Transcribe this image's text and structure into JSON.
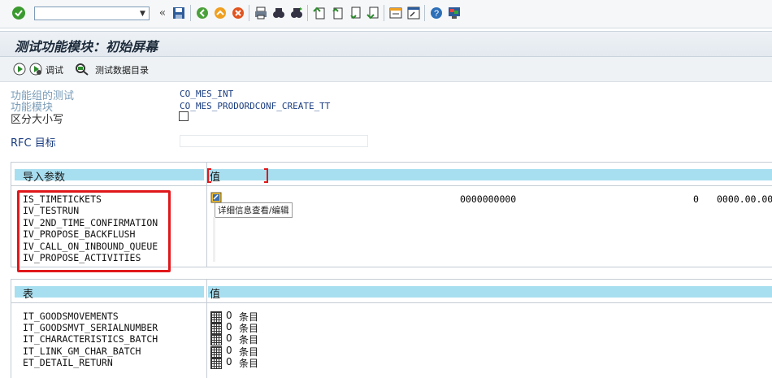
{
  "toolbar": {
    "command_field_value": "",
    "icons": [
      "enter-check-icon",
      "command-field",
      "nav-back-double-icon",
      "save-icon",
      "back-icon",
      "exit-icon",
      "cancel-icon",
      "print-icon",
      "find-icon",
      "find-next-icon",
      "first-page-icon",
      "previous-page-icon",
      "next-page-icon",
      "last-page-icon",
      "create-session-icon",
      "shortcut-icon",
      "help-icon",
      "customize-layout-icon"
    ]
  },
  "title": "测试功能模块：初始屏幕",
  "app_toolbar": {
    "test_label": "调试",
    "test_data_directory_label": "测试数据目录"
  },
  "fields": {
    "function_group_label": "功能组的测试",
    "function_group_value": "CO_MES_INT",
    "function_module_label": "功能模块",
    "function_module_value": "CO_MES_PRODORDCONF_CREATE_TT",
    "case_sensitive_label": "区分大小写",
    "case_sensitive_checked": false,
    "rfc_target_label": "RFC 目标",
    "rfc_target_value": ""
  },
  "import_params": {
    "col_param": "导入参数",
    "col_value": "值",
    "rows": [
      {
        "name": "IS_TIMETICKETS"
      },
      {
        "name": "IV_TESTRUN"
      },
      {
        "name": "IV_2ND_TIME_CONFIRMATION"
      },
      {
        "name": "IV_PROPOSE_BACKFLUSH"
      },
      {
        "name": "IV_CALL_ON_INBOUND_QUEUE"
      },
      {
        "name": "IV_PROPOSE_ACTIVITIES"
      }
    ],
    "first_row_values": {
      "v1": "0000000000",
      "v2": "0",
      "v3": "0000.00.00"
    },
    "tooltip": "详细信息查看/编辑"
  },
  "tables": {
    "col_table": "表",
    "col_value": "值",
    "rows": [
      {
        "name": "IT_GOODSMOVEMENTS",
        "count": "0",
        "unit": "条目"
      },
      {
        "name": "IT_GOODSMVT_SERIALNUMBER",
        "count": "0",
        "unit": "条目"
      },
      {
        "name": "IT_CHARACTERISTICS_BATCH",
        "count": "0",
        "unit": "条目"
      },
      {
        "name": "IT_LINK_GM_CHAR_BATCH",
        "count": "0",
        "unit": "条目"
      },
      {
        "name": "ET_DETAIL_RETURN",
        "count": "0",
        "unit": "条目"
      }
    ]
  },
  "colors": {
    "header_band": "#a8dff0",
    "highlight_box": "#e0181b",
    "label": "#7a9cb8",
    "value": "#1a3c80"
  }
}
